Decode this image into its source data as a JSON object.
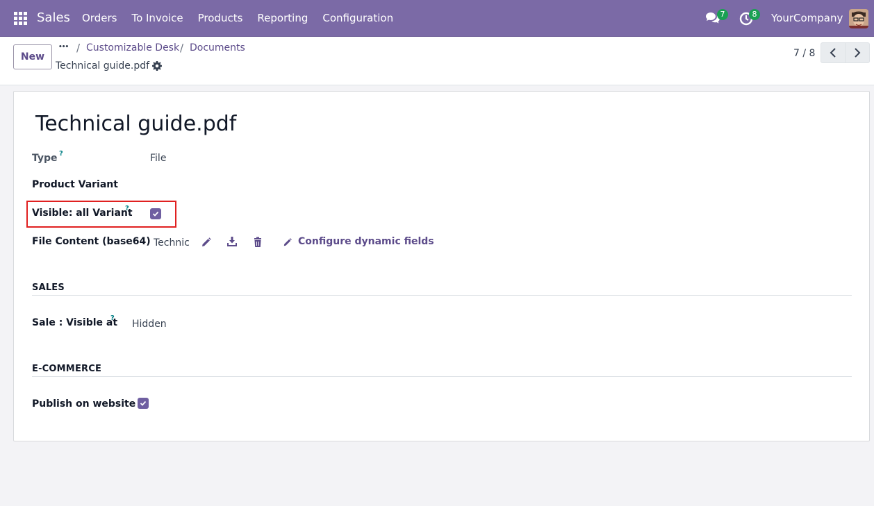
{
  "navbar": {
    "app_name": "Sales",
    "menu": [
      "Orders",
      "To Invoice",
      "Products",
      "Reporting",
      "Configuration"
    ],
    "chat_count": "7",
    "activity_count": "8",
    "company": "YourCompany",
    "brand_color": "#7b6aa6"
  },
  "control": {
    "new_label": "New",
    "breadcrumb_dots": "•••",
    "breadcrumbs": [
      "Customizable Desk",
      "Documents"
    ],
    "record_title": "Technical guide.pdf",
    "pager": "7 / 8"
  },
  "form": {
    "title": "Technical guide.pdf",
    "type_label": "Type",
    "type_help": "?",
    "type_value": "File",
    "product_variant_label": "Product Variant",
    "visible_label": "Visible: all Variant",
    "visible_help": "?",
    "visible_checked": true,
    "file_content_label": "File Content (base64)",
    "file_content_value": "Technic",
    "configure_label": "Configure dynamic fields",
    "sales_section": "SALES",
    "sale_visible_label": "Sale : Visible at",
    "sale_visible_help": "?",
    "sale_visible_value": "Hidden",
    "ecommerce_section": "E-COMMERCE",
    "publish_label": "Publish on website",
    "publish_checked": true
  }
}
